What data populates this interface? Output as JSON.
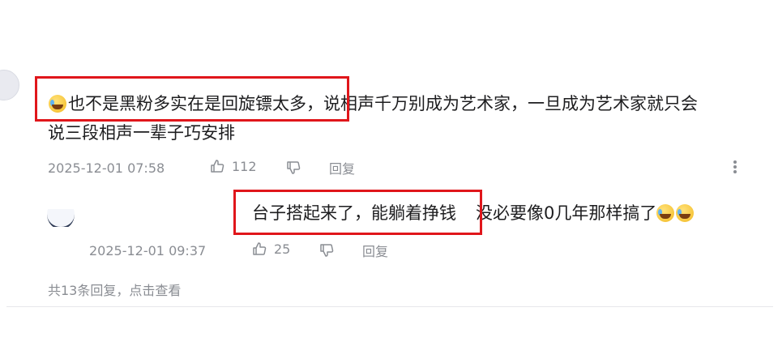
{
  "comment": {
    "emoji_icon": "laughing-crying-emoji",
    "highlighted_text": "也不是黑粉多实在是回旋镖太多，",
    "rest_text": "说相声千万别成为艺术家，一旦成为艺术家就只会",
    "text_line2": "说三段相声一辈子巧安排",
    "timestamp": "2025-12-01 07:58",
    "like_count": "112",
    "reply_label": "回复"
  },
  "reply": {
    "highlighted_text": "台子搭起来了，能躺着挣钱",
    "rest_text": "没必要像0几年那样搞了",
    "trailing_emojis": [
      "laughing-crying-emoji",
      "laughing-crying-emoji"
    ],
    "timestamp": "2025-12-01 09:37",
    "like_count": "25",
    "reply_label": "回复"
  },
  "footer": {
    "more_replies_label": "共13条回复，点击查看"
  },
  "colors": {
    "highlight_border": "#e0161b",
    "meta_text": "#8a8d93",
    "body_text": "#1d1d1f"
  }
}
